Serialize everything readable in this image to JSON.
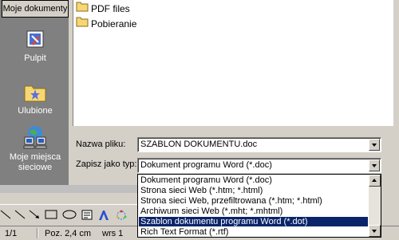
{
  "sidebar": {
    "items": [
      {
        "label": "Moje dokumenty",
        "icon": "my-documents-icon",
        "selected": true
      },
      {
        "label": "Pulpit",
        "icon": "desktop-icon"
      },
      {
        "label": "Ulubione",
        "icon": "favorites-folder-icon"
      },
      {
        "label_line1": "Moje miejsca",
        "label_line2": "sieciowe",
        "icon": "network-places-icon"
      }
    ]
  },
  "files": [
    {
      "name": "PDF files",
      "icon": "folder-icon"
    },
    {
      "name": "Pobieranie",
      "icon": "folder-icon"
    }
  ],
  "form": {
    "filename_label": "Nazwa pliku:",
    "filename_value": "SZABLON DOKUMENTU.doc",
    "type_label": "Zapisz jako typ:",
    "type_value": "Dokument programu Word (*.doc)"
  },
  "type_options": [
    {
      "label": "Dokument programu Word (*.doc)"
    },
    {
      "label": "Strona sieci Web (*.htm; *.html)"
    },
    {
      "label": "Strona sieci Web, przefiltrowana (*.htm; *.html)"
    },
    {
      "label": "Archiwum sieci Web (*.mht; *.mhtml)"
    },
    {
      "label": "Szablon dokumentu programu Word (*.dot)",
      "selected": true
    },
    {
      "label": "Rich Text Format (*.rtf)"
    }
  ],
  "statusbar": {
    "page": "1/1",
    "position": "Poz. 2,4 cm",
    "line": "wrs 1"
  },
  "colors": {
    "dialog_bg": "#d4d0c8",
    "sidebar_bg": "#808080",
    "selection": "#0a246a",
    "folder": "#f7d774"
  }
}
